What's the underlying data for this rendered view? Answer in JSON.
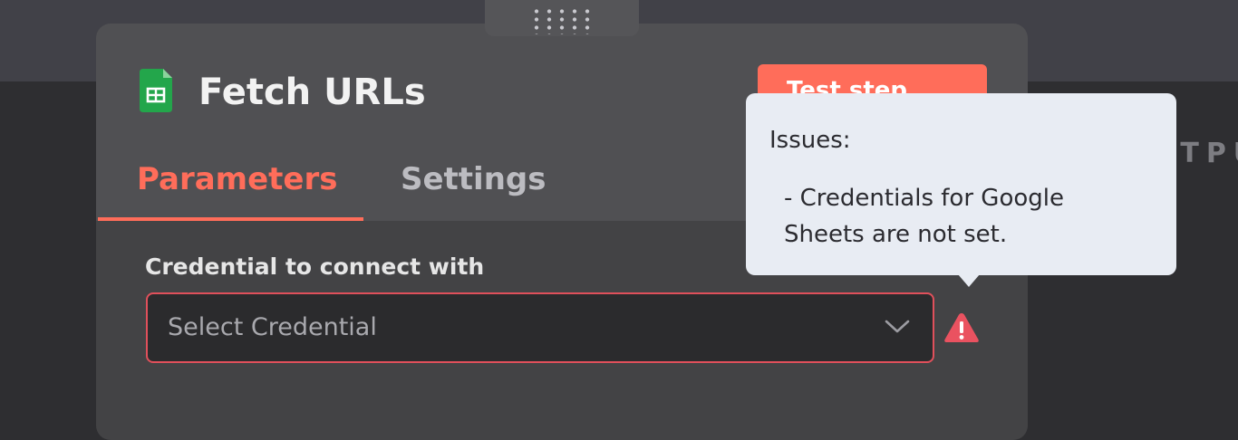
{
  "node": {
    "title": "Fetch URLs",
    "test_step_label": "Test step",
    "icon": "google-sheets-icon"
  },
  "tabs": [
    {
      "label": "Parameters",
      "active": true
    },
    {
      "label": "Settings",
      "active": false
    }
  ],
  "credential": {
    "label": "Credential to connect with",
    "value": "Select Credential",
    "has_issue": true
  },
  "tooltip": {
    "title": "Issues:",
    "lines": [
      "- Credentials for Google",
      "Sheets are not set."
    ]
  },
  "background": {
    "output_label": "UTPUT"
  },
  "colors": {
    "accent": "#ff6d5a",
    "error_border": "#e0505b",
    "warning": "#ea5260",
    "sheets_green": "#23a64b"
  }
}
